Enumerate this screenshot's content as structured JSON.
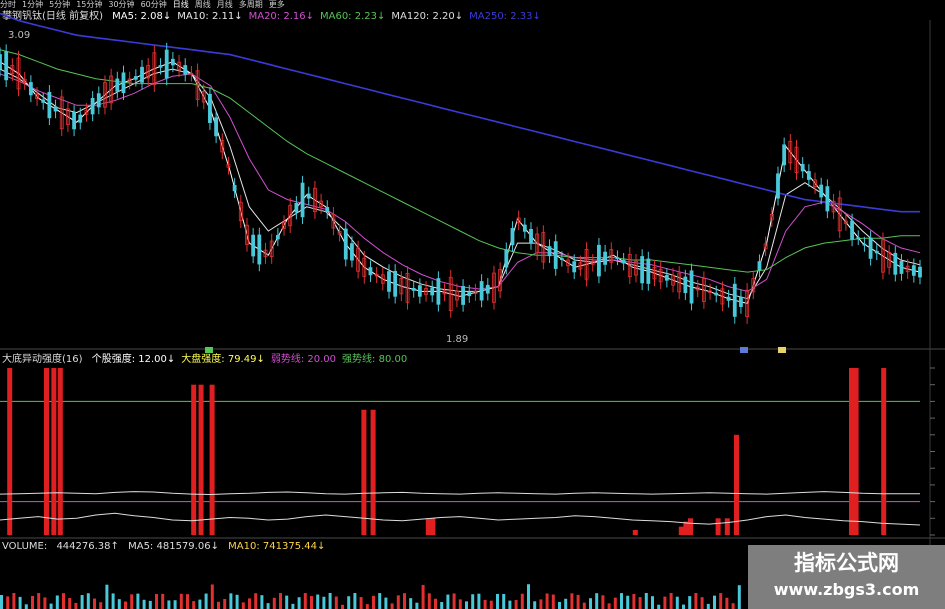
{
  "toolbar": {
    "periods": [
      "分时",
      "1分钟",
      "5分钟",
      "15分钟",
      "30分钟",
      "60分钟",
      "日线",
      "周线",
      "月线",
      "多周期",
      "更多"
    ],
    "active_index": 6
  },
  "main_panel": {
    "stock_name": "攀钢钒钛(日线 前复权)",
    "ma": [
      {
        "label": "MA5:",
        "value": "2.08",
        "arrow": "↓",
        "color": "#ffffff"
      },
      {
        "label": "MA10:",
        "value": "2.11",
        "arrow": "↓",
        "color": "#e8e8e8"
      },
      {
        "label": "MA20:",
        "value": "2.16",
        "arrow": "↓",
        "color": "#d14fd1"
      },
      {
        "label": "MA60:",
        "value": "2.23",
        "arrow": "↓",
        "color": "#56c456"
      },
      {
        "label": "MA120:",
        "value": "2.20",
        "arrow": "↓",
        "color": "#dddddd"
      },
      {
        "label": "MA250:",
        "value": "2.33",
        "arrow": "↓",
        "color": "#3b3bd8"
      }
    ],
    "high_label": "3.09",
    "low_label": "1.89"
  },
  "indicator_panel": {
    "name": "大底异动强度(16)",
    "items": [
      {
        "label": "个股强度:",
        "value": "12.00",
        "arrow": "↓",
        "color": "#ffffff"
      },
      {
        "label": "大盘强度:",
        "value": "79.49",
        "arrow": "↓",
        "color": "#ffff55"
      },
      {
        "label": "弱势线:",
        "value": "20.00",
        "color": "#d14fd1"
      },
      {
        "label": "强势线:",
        "value": "80.00",
        "color": "#56c456"
      }
    ]
  },
  "volume_panel": {
    "name": "VOLUME:",
    "value": "444276.38",
    "arrow": "↑",
    "ma5_label": "MA5:",
    "ma5": "481579.06",
    "ma5_arrow": "↓",
    "ma10_label": "MA10:",
    "ma10": "741375.44",
    "ma10_arrow": "↓"
  },
  "chart_data": [
    {
      "type": "line",
      "title": "攀钢钒钛(日线 前复权)",
      "ylim": [
        1.89,
        3.09
      ],
      "series": [
        {
          "name": "MA5",
          "values": [
            2.95,
            2.9,
            2.8,
            2.75,
            2.7,
            2.78,
            2.85,
            2.88,
            2.92,
            2.95,
            2.9,
            2.75,
            2.5,
            2.2,
            2.15,
            2.3,
            2.4,
            2.35,
            2.2,
            2.1,
            2.05,
            2.02,
            2.0,
            2.0,
            1.98,
            2.0,
            2.02,
            2.3,
            2.2,
            2.15,
            2.1,
            2.12,
            2.15,
            2.1,
            2.08,
            2.05,
            2.02,
            2.0,
            1.97,
            1.95,
            2.2,
            2.6,
            2.5,
            2.4,
            2.3,
            2.2,
            2.15,
            2.1,
            2.08
          ]
        },
        {
          "name": "MA10",
          "values": [
            2.92,
            2.88,
            2.82,
            2.76,
            2.74,
            2.78,
            2.82,
            2.86,
            2.9,
            2.92,
            2.9,
            2.8,
            2.6,
            2.35,
            2.25,
            2.3,
            2.35,
            2.33,
            2.25,
            2.15,
            2.1,
            2.06,
            2.03,
            2.01,
            2.0,
            2.0,
            2.02,
            2.2,
            2.2,
            2.17,
            2.13,
            2.12,
            2.13,
            2.11,
            2.09,
            2.07,
            2.04,
            2.02,
            1.99,
            1.97,
            2.1,
            2.4,
            2.45,
            2.4,
            2.33,
            2.25,
            2.18,
            2.13,
            2.11
          ]
        },
        {
          "name": "MA20",
          "values": [
            2.9,
            2.87,
            2.83,
            2.8,
            2.77,
            2.77,
            2.79,
            2.82,
            2.86,
            2.89,
            2.9,
            2.85,
            2.72,
            2.55,
            2.42,
            2.38,
            2.36,
            2.34,
            2.29,
            2.22,
            2.16,
            2.11,
            2.07,
            2.04,
            2.02,
            2.01,
            2.02,
            2.12,
            2.16,
            2.16,
            2.14,
            2.13,
            2.13,
            2.12,
            2.11,
            2.09,
            2.07,
            2.05,
            2.02,
            2.0,
            2.05,
            2.25,
            2.35,
            2.37,
            2.33,
            2.28,
            2.22,
            2.18,
            2.16
          ]
        },
        {
          "name": "MA60",
          "values": [
            3.0,
            2.98,
            2.95,
            2.92,
            2.9,
            2.88,
            2.87,
            2.86,
            2.86,
            2.86,
            2.86,
            2.84,
            2.8,
            2.74,
            2.68,
            2.62,
            2.57,
            2.53,
            2.49,
            2.45,
            2.41,
            2.37,
            2.33,
            2.29,
            2.25,
            2.21,
            2.18,
            2.16,
            2.15,
            2.15,
            2.14,
            2.14,
            2.14,
            2.13,
            2.13,
            2.12,
            2.11,
            2.1,
            2.09,
            2.08,
            2.09,
            2.14,
            2.18,
            2.2,
            2.21,
            2.22,
            2.22,
            2.23,
            2.23
          ]
        },
        {
          "name": "MA250",
          "values": [
            3.15,
            3.12,
            3.1,
            3.08,
            3.06,
            3.05,
            3.04,
            3.03,
            3.02,
            3.01,
            3.0,
            2.99,
            2.98,
            2.96,
            2.94,
            2.92,
            2.9,
            2.88,
            2.86,
            2.84,
            2.82,
            2.8,
            2.78,
            2.76,
            2.74,
            2.72,
            2.7,
            2.68,
            2.66,
            2.64,
            2.62,
            2.6,
            2.58,
            2.56,
            2.54,
            2.52,
            2.5,
            2.48,
            2.46,
            2.44,
            2.42,
            2.4,
            2.38,
            2.37,
            2.36,
            2.35,
            2.34,
            2.33,
            2.33
          ]
        }
      ]
    },
    {
      "type": "bar",
      "title": "大底异动强度(16)",
      "ylim": [
        0,
        100
      ],
      "signal_bars_x": [
        0.01,
        0.05,
        0.058,
        0.065,
        0.21,
        0.218,
        0.23,
        0.395,
        0.405,
        0.465,
        0.47,
        0.69,
        0.74,
        0.745,
        0.75,
        0.78,
        0.79,
        0.8,
        0.925,
        0.93,
        0.96
      ],
      "signal_bars_values": [
        100,
        100,
        100,
        100,
        90,
        90,
        90,
        75,
        75,
        10,
        10,
        3,
        5,
        8,
        10,
        10,
        10,
        60,
        100,
        100,
        100
      ],
      "series": [
        {
          "name": "个股强度",
          "values": [
            18,
            20,
            22,
            19,
            20,
            24,
            26,
            23,
            21,
            18,
            17,
            19,
            21,
            20,
            18,
            19,
            22,
            24,
            22,
            20,
            18,
            17,
            19,
            21,
            22,
            20,
            18,
            19,
            20,
            21,
            23,
            22,
            20,
            18,
            17,
            16,
            14,
            13,
            15,
            18,
            22,
            24,
            21,
            19,
            17,
            16,
            14,
            13,
            12
          ]
        },
        {
          "name": "大盘强度",
          "values": [
            78,
            79,
            80,
            81,
            80,
            79,
            82,
            84,
            83,
            80,
            78,
            77,
            79,
            80,
            82,
            83,
            81,
            79,
            78,
            80,
            81,
            82,
            80,
            79,
            78,
            80,
            81,
            80,
            79,
            78,
            80,
            81,
            80,
            79,
            78,
            79,
            80,
            81,
            80,
            79,
            78,
            80,
            82,
            84,
            82,
            80,
            79,
            79,
            79
          ]
        },
        {
          "name": "弱势线",
          "values": [
            20,
            20
          ]
        },
        {
          "name": "强势线",
          "values": [
            80,
            80
          ]
        }
      ]
    }
  ],
  "watermark": {
    "title": "指标公式网",
    "url": "www.zbgs3.com"
  }
}
